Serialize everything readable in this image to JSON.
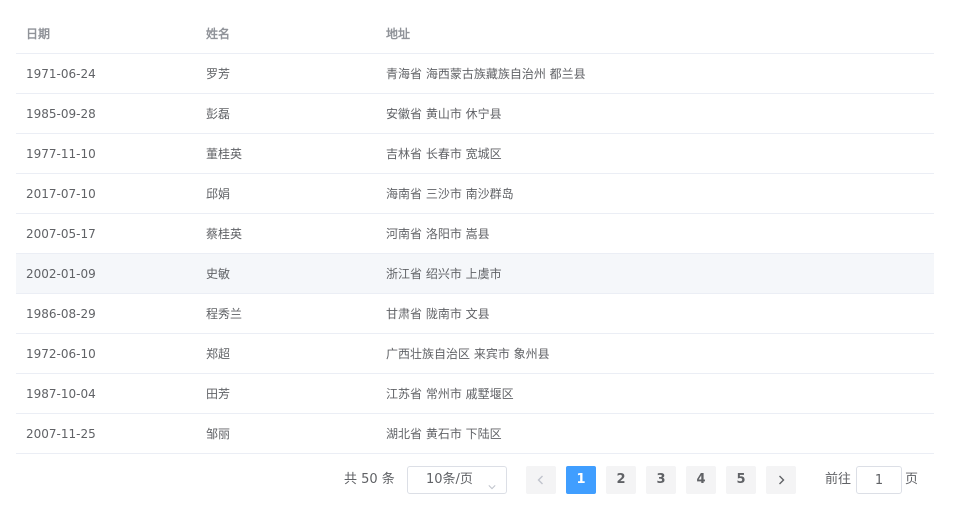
{
  "table": {
    "headers": {
      "date": "日期",
      "name": "姓名",
      "address": "地址"
    },
    "rows": [
      {
        "date": "1971-06-24",
        "name": "罗芳",
        "address": "青海省 海西蒙古族藏族自治州 都兰县"
      },
      {
        "date": "1985-09-28",
        "name": "彭磊",
        "address": "安徽省 黄山市 休宁县"
      },
      {
        "date": "1977-11-10",
        "name": "董桂英",
        "address": "吉林省 长春市 宽城区"
      },
      {
        "date": "2017-07-10",
        "name": "邱娟",
        "address": "海南省 三沙市 南沙群岛"
      },
      {
        "date": "2007-05-17",
        "name": "蔡桂英",
        "address": "河南省 洛阳市 嵩县"
      },
      {
        "date": "2002-01-09",
        "name": "史敏",
        "address": "浙江省 绍兴市 上虞市"
      },
      {
        "date": "1986-08-29",
        "name": "程秀兰",
        "address": "甘肃省 陇南市 文县"
      },
      {
        "date": "1972-06-10",
        "name": "郑超",
        "address": "广西壮族自治区 来宾市 象州县"
      },
      {
        "date": "1987-10-04",
        "name": "田芳",
        "address": "江苏省 常州市 戚墅堰区"
      },
      {
        "date": "2007-11-25",
        "name": "邹丽",
        "address": "湖北省 黄石市 下陆区"
      }
    ]
  },
  "pagination": {
    "total_text": "共 50 条",
    "page_size_value": "10条/页",
    "pages": [
      "1",
      "2",
      "3",
      "4",
      "5"
    ],
    "current_page": "1",
    "goto_label": "前往",
    "goto_value": "1",
    "page_unit": "页",
    "prev_icon": "chevron-left-icon",
    "next_icon": "chevron-right-icon",
    "dropdown_icon": "chevron-down-icon",
    "active_color": "#409eff"
  }
}
